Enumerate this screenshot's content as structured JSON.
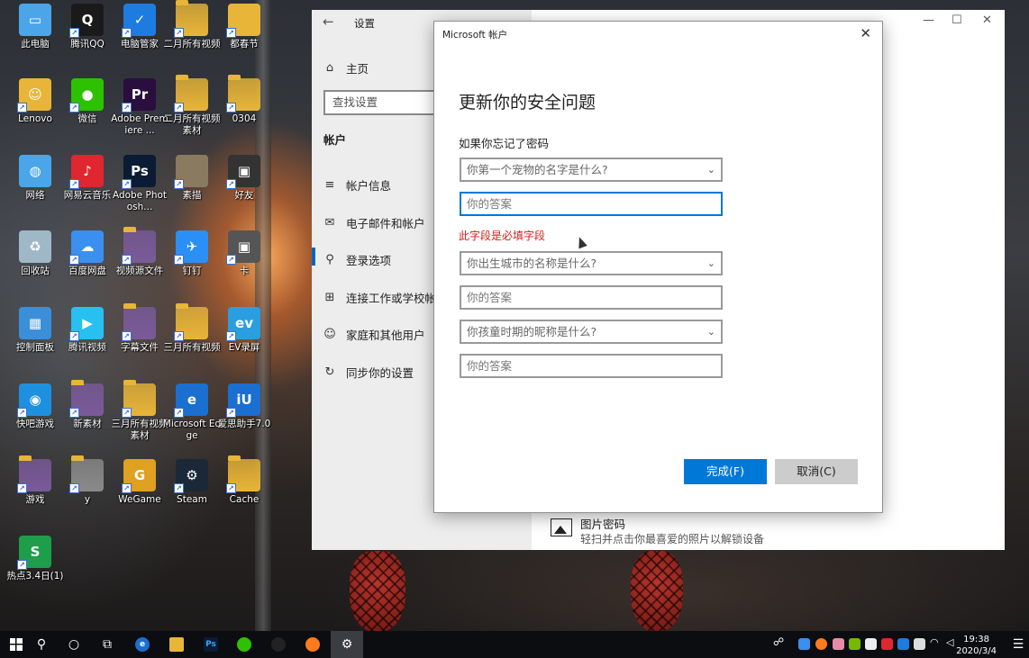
{
  "desktop": {
    "icons": [
      {
        "label": "此电脑",
        "icon": "computer-icon",
        "color": "#4aa6e8"
      },
      {
        "label": "腾讯QQ",
        "icon": "qq-penguin-icon",
        "color": "#1a1a1a"
      },
      {
        "label": "电脑管家",
        "icon": "shield-icon",
        "color": "#1e7be0"
      },
      {
        "label": "二月所有视频",
        "icon": "folder-icon",
        "color": "#e8b538"
      },
      {
        "label": "都春节",
        "icon": "file-icon",
        "color": "#e8b538"
      },
      {
        "label": "Lenovo",
        "icon": "user-folder-icon",
        "color": "#e8b538"
      },
      {
        "label": "微信",
        "icon": "wechat-icon",
        "color": "#2dc100"
      },
      {
        "label": "Adobe Premiere ...",
        "icon": "premiere-icon",
        "color": "#2a0e3e"
      },
      {
        "label": "二月所有视频素材",
        "icon": "folder-icon",
        "color": "#e8b538"
      },
      {
        "label": "0304",
        "icon": "folder-icon",
        "color": "#e8b538"
      },
      {
        "label": "网络",
        "icon": "network-icon",
        "color": "#4aa6e8"
      },
      {
        "label": "网易云音乐",
        "icon": "netease-music-icon",
        "color": "#e0262f"
      },
      {
        "label": "Adobe Photosh...",
        "icon": "photoshop-icon",
        "color": "#0b1b33"
      },
      {
        "label": "素描",
        "icon": "file-icon",
        "color": "#8a7a60"
      },
      {
        "label": "好友",
        "icon": "video-thumb-icon",
        "color": "#333333"
      },
      {
        "label": "回收站",
        "icon": "recycle-bin-icon",
        "color": "#9fb8c8"
      },
      {
        "label": "百度网盘",
        "icon": "baidu-netdisk-icon",
        "color": "#3a8ff0"
      },
      {
        "label": "视频源文件",
        "icon": "folder-icon",
        "color": "#7a5a9a"
      },
      {
        "label": "钉钉",
        "icon": "dingtalk-icon",
        "color": "#2a8ff7"
      },
      {
        "label": "卡",
        "icon": "video-thumb-icon",
        "color": "#555555"
      },
      {
        "label": "控制面板",
        "icon": "control-panel-icon",
        "color": "#3a8fd8"
      },
      {
        "label": "腾讯视频",
        "icon": "tencent-video-icon",
        "color": "#28c0f0"
      },
      {
        "label": "字幕文件",
        "icon": "folder-icon",
        "color": "#7a5a9a"
      },
      {
        "label": "三月所有视频",
        "icon": "folder-icon",
        "color": "#e8b538"
      },
      {
        "label": "EV录屏",
        "icon": "ev-recorder-icon",
        "color": "#2a9fe0"
      },
      {
        "label": "快吧游戏",
        "icon": "game-icon",
        "color": "#1e90e0"
      },
      {
        "label": "新素材",
        "icon": "folder-icon",
        "color": "#7a5a9a"
      },
      {
        "label": "三月所有视频素材",
        "icon": "folder-icon",
        "color": "#e8b538"
      },
      {
        "label": "Microsoft Edge",
        "icon": "edge-icon",
        "color": "#1a6fd0"
      },
      {
        "label": "爱思助手7.0",
        "icon": "i4-icon",
        "color": "#1a6fd0"
      },
      {
        "label": "游戏",
        "icon": "folder-icon",
        "color": "#7a5a9a"
      },
      {
        "label": "y",
        "icon": "folder-icon",
        "color": "#8a8a8a"
      },
      {
        "label": "WeGame",
        "icon": "wegame-icon",
        "color": "#e0a020"
      },
      {
        "label": "Steam",
        "icon": "steam-icon",
        "color": "#1b2838"
      },
      {
        "label": "Cache",
        "icon": "folder-icon",
        "color": "#e8b538"
      },
      {
        "label": "热点3.4日(1)",
        "icon": "spreadsheet-icon",
        "color": "#1e9e4a"
      }
    ]
  },
  "settings": {
    "title": "设置",
    "back_icon": "back-arrow-icon",
    "home_label": "主页",
    "search_placeholder": "查找设置",
    "section_title": "帐户",
    "nav_items": [
      {
        "label": "帐户信息",
        "icon": "account-info-icon"
      },
      {
        "label": "电子邮件和帐户",
        "icon": "mail-icon"
      },
      {
        "label": "登录选项",
        "icon": "key-icon"
      },
      {
        "label": "连接工作或学校帐户",
        "icon": "briefcase-icon"
      },
      {
        "label": "家庭和其他用户",
        "icon": "person-icon"
      },
      {
        "label": "同步你的设置",
        "icon": "sync-icon"
      }
    ],
    "picture_password": {
      "title": "图片密码",
      "description": "轻扫并点击你最喜爱的照片以解锁设备"
    }
  },
  "dialog": {
    "window_title": "Microsoft 帐户",
    "heading": "更新你的安全问题",
    "subheading": "如果你忘记了密码",
    "questions": [
      {
        "question": "你第一个宠物的名字是什么?",
        "answer_placeholder": "你的答案"
      },
      {
        "question": "你出生城市的名称是什么?",
        "answer_placeholder": "你的答案"
      },
      {
        "question": "你孩童时期的昵称是什么?",
        "answer_placeholder": "你的答案"
      }
    ],
    "error_message": "此字段是必填字段",
    "finish_button": "完成(F)",
    "cancel_button": "取消(C)",
    "accent_color": "#0078d7",
    "error_color": "#d61c1c"
  },
  "taskbar": {
    "clock_time": "19:38",
    "clock_date": "2020/3/4",
    "items": [
      "start-icon",
      "search-icon",
      "cortana-icon",
      "task-view-icon",
      "edge-icon",
      "file-explorer-icon",
      "photoshop-icon",
      "wechat-icon",
      "qq-icon",
      "firefox-icon",
      "settings-gear-icon"
    ]
  }
}
